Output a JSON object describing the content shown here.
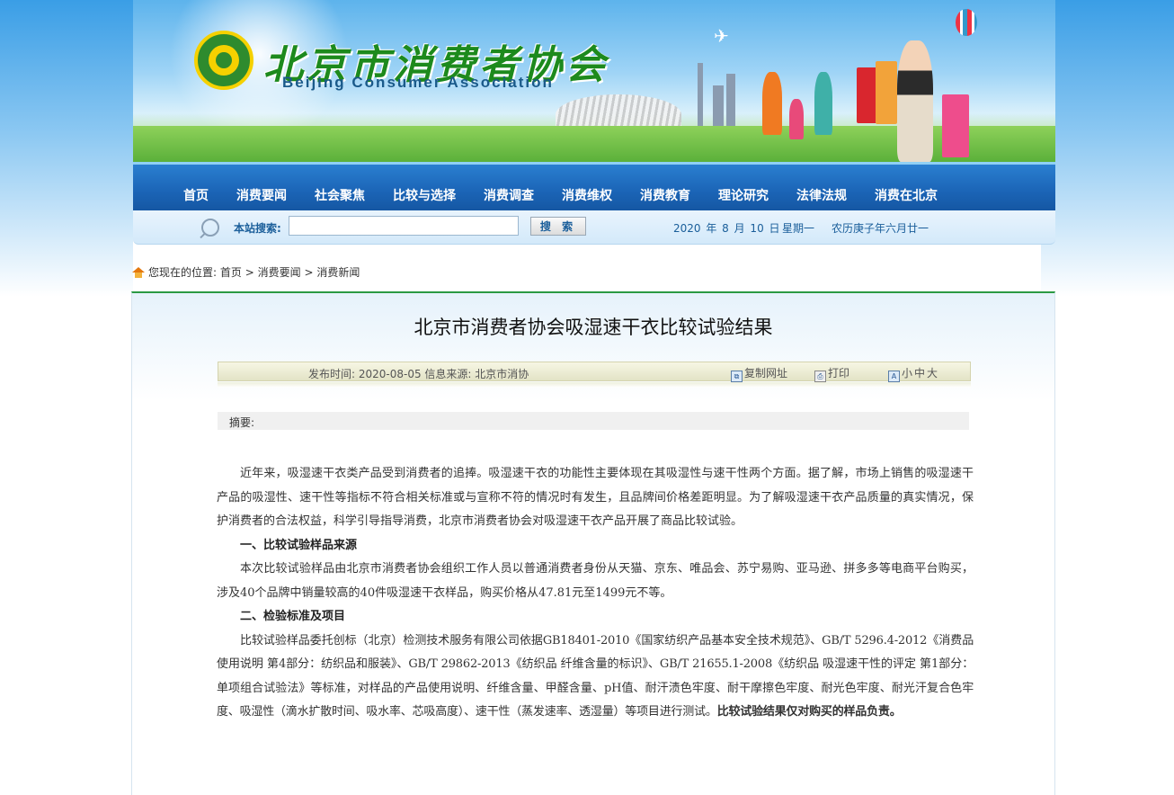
{
  "header": {
    "logo_cn": "北京市消费者协会",
    "logo_en": "Beijing Consumer Association"
  },
  "nav": {
    "items": [
      {
        "label": "首页"
      },
      {
        "label": "消费要闻"
      },
      {
        "label": "社会聚焦"
      },
      {
        "label": "比较与选择"
      },
      {
        "label": "消费调查"
      },
      {
        "label": "消费维权"
      },
      {
        "label": "消费教育"
      },
      {
        "label": "理论研究"
      },
      {
        "label": "法律法规"
      },
      {
        "label": "消费在北京"
      }
    ]
  },
  "search": {
    "label": "本站搜索:",
    "value": "",
    "button": "搜 索",
    "date": "2020 年 8 月 10 日",
    "weekday": "星期一",
    "lunar": "农历庚子年六月廿一"
  },
  "breadcrumb": {
    "prefix": "您现在的位置:",
    "home": "首页",
    "sep1": ">",
    "section": "消费要闻",
    "sep2": ">",
    "current": "消费新闻"
  },
  "article": {
    "title": "北京市消费者协会吸湿速干衣比较试验结果",
    "meta": "发布时间: 2020-08-05  信息来源: 北京市消协",
    "copy_url": "复制网址",
    "print": "打印",
    "font_small": "小",
    "font_mid": "中",
    "font_large": "大",
    "summary_label": "摘要:",
    "paragraphs": {
      "p1": "近年来，吸湿速干衣类产品受到消费者的追捧。吸湿速干衣的功能性主要体现在其吸湿性与速干性两个方面。据了解，市场上销售的吸湿速干产品的吸湿性、速干性等指标不符合相关标准或与宣称不符的情况时有发生，且品牌间价格差距明显。为了解吸湿速干衣产品质量的真实情况，保护消费者的合法权益，科学引导指导消费，北京市消费者协会对吸湿速干衣产品开展了商品比较试验。",
      "h1": "一、比较试验样品来源",
      "p2": "本次比较试验样品由北京市消费者协会组织工作人员以普通消费者身份从天猫、京东、唯品会、苏宁易购、亚马逊、拼多多等电商平台购买，涉及40个品牌中销量较高的40件吸湿速干衣样品，购买价格从47.81元至1499元不等。",
      "h2": "二、检验标准及项目",
      "p3": "比较试验样品委托创标（北京）检测技术服务有限公司依据GB18401-2010《国家纺织产品基本安全技术规范》、GB/T 5296.4-2012《消费品使用说明 第4部分：纺织品和服装》、GB/T 29862-2013《纺织品 纤维含量的标识》、GB/T 21655.1-2008《纺织品 吸湿速干性的评定 第1部分：单项组合试验法》等标准，对样品的产品使用说明、纤维含量、甲醛含量、pH值、耐汗渍色牢度、耐干摩擦色牢度、耐光色牢度、耐光汗复合色牢度、吸湿性（滴水扩散时间、吸水率、芯吸高度）、速干性（蒸发速率、透湿量）等项目进行测试。",
      "p3_bold": "比较试验结果仅对购买的样品负责。"
    }
  }
}
